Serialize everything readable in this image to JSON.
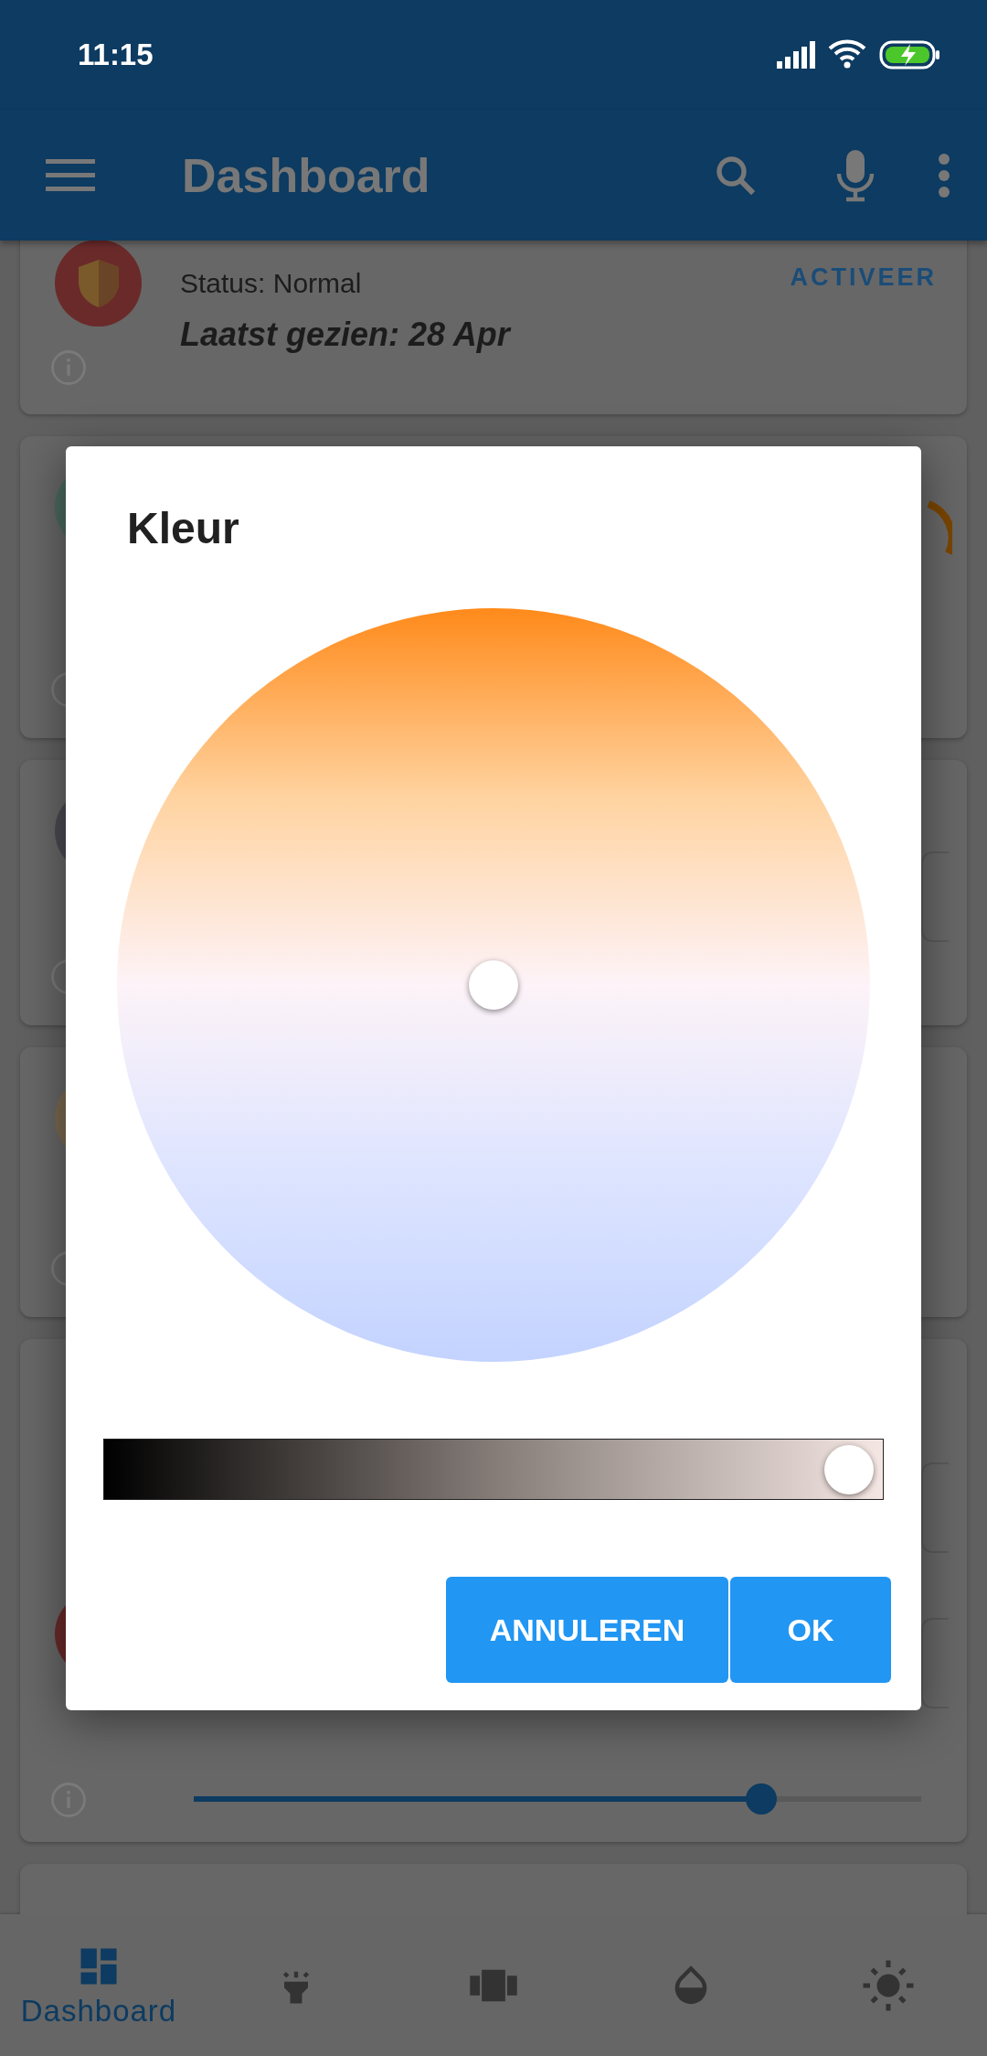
{
  "status_bar": {
    "time": "11:15"
  },
  "app_bar": {
    "title": "Dashboard"
  },
  "cards": [
    {
      "kind": "alarm",
      "status": "Status: Normal",
      "last_seen": "Laatst gezien: 28 Apr",
      "action": "ACTIVEER"
    },
    {
      "kind": "gauge"
    },
    {
      "kind": "box"
    },
    {
      "kind": "plain"
    },
    {
      "kind": "slider",
      "level": 0.78
    },
    {
      "kind": "empty"
    }
  ],
  "dialog": {
    "title": "Kleur",
    "brightness": {
      "level": 0.96
    },
    "buttons": [
      {
        "label": "ANNULEREN"
      },
      {
        "label": "OK"
      }
    ]
  },
  "bottom_nav": [
    {
      "label": "Dashboard",
      "selected": true
    },
    {
      "selected": false
    },
    {
      "selected": false
    },
    {
      "selected": false
    },
    {
      "selected": false
    }
  ]
}
